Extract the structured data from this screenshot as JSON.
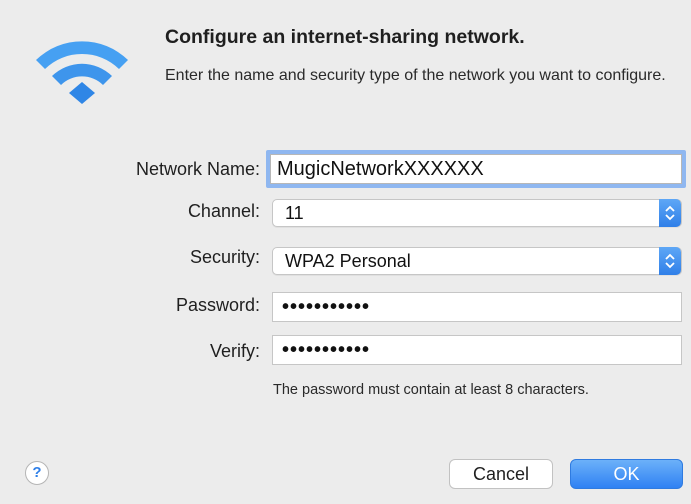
{
  "dialog": {
    "title": "Configure an internet-sharing network.",
    "subtitle": "Enter the name and security type of the network you want to configure.",
    "icon": "wifi-icon",
    "accent_color": "#2f7fe8"
  },
  "form": {
    "network_name": {
      "label": "Network Name:",
      "value": "MugicNetworkXXXXXX"
    },
    "channel": {
      "label": "Channel:",
      "value": "11"
    },
    "security": {
      "label": "Security:",
      "value": "WPA2 Personal"
    },
    "password": {
      "label": "Password:",
      "value": "•••••••••••"
    },
    "verify": {
      "label": "Verify:",
      "value": "•••••••••••"
    },
    "hint": "The password must contain at least 8 characters."
  },
  "buttons": {
    "help": "?",
    "cancel": "Cancel",
    "ok": "OK"
  }
}
